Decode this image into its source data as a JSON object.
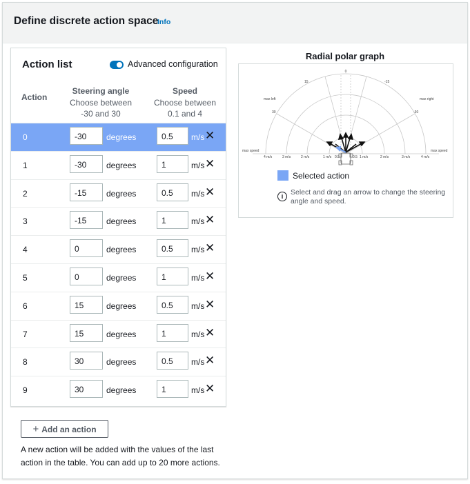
{
  "header": {
    "title": "Define discrete action space",
    "info_link": "Info"
  },
  "action_list": {
    "title": "Action list",
    "advanced_label": "Advanced configuration",
    "advanced_on": true,
    "col_action": "Action",
    "col_steer_title": "Steering angle",
    "col_steer_sub": "Choose between -30 and 30",
    "col_speed_title": "Speed",
    "col_speed_sub": "Choose between 0.1 and 4",
    "rows": [
      {
        "idx": "0",
        "steer": "-30",
        "deg": "degrees",
        "speed": "0.5",
        "unit": "m/s",
        "selected": true
      },
      {
        "idx": "1",
        "steer": "-30",
        "deg": "degrees",
        "speed": "1",
        "unit": "m/s"
      },
      {
        "idx": "2",
        "steer": "-15",
        "deg": "degrees",
        "speed": "0.5",
        "unit": "m/s"
      },
      {
        "idx": "3",
        "steer": "-15",
        "deg": "degrees",
        "speed": "1",
        "unit": "m/s"
      },
      {
        "idx": "4",
        "steer": "0",
        "deg": "degrees",
        "speed": "0.5",
        "unit": "m/s"
      },
      {
        "idx": "5",
        "steer": "0",
        "deg": "degrees",
        "speed": "1",
        "unit": "m/s"
      },
      {
        "idx": "6",
        "steer": "15",
        "deg": "degrees",
        "speed": "0.5",
        "unit": "m/s"
      },
      {
        "idx": "7",
        "steer": "15",
        "deg": "degrees",
        "speed": "1",
        "unit": "m/s"
      },
      {
        "idx": "8",
        "steer": "30",
        "deg": "degrees",
        "speed": "0.5",
        "unit": "m/s"
      },
      {
        "idx": "9",
        "steer": "30",
        "deg": "degrees",
        "speed": "1",
        "unit": "m/s"
      }
    ],
    "delete_icon": "close-icon",
    "add_button": "Add an action",
    "note": "A new action will be added with the values of the last action in the table. You can add up to 20 more actions."
  },
  "graph": {
    "title": "Radial polar graph",
    "angle_labels": {
      "top": "0",
      "left15": "15",
      "right15": "-15",
      "left30": "30",
      "right30": "-30",
      "max_left": "max left",
      "max_right": "max right"
    },
    "speed_labels": [
      "4 m/s",
      "3 m/s",
      "2 m/s",
      "1 m/s",
      "0.5",
      "0.5",
      "1 m/s",
      "2 m/s",
      "3 m/s",
      "4 m/s"
    ],
    "max_speed": "max speed",
    "legend": "Selected action",
    "help": "Select and drag an arrow to change the steering angle and speed.",
    "selected_color": "#7aa6f5"
  }
}
